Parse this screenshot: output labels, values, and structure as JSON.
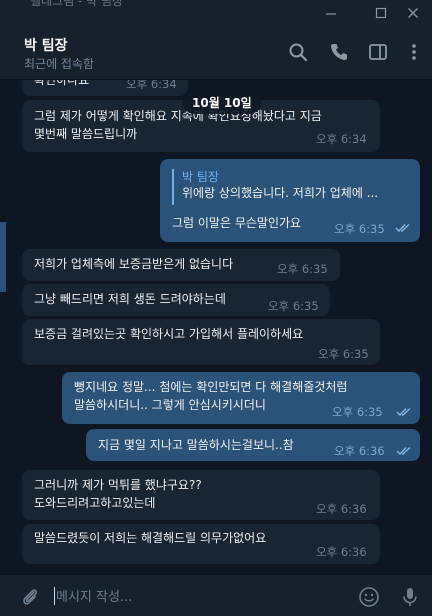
{
  "titlebar": {
    "ghost_text": "텔레그램 - 박 팀장"
  },
  "header": {
    "name": "박 팀장",
    "status": "최근에 접속함"
  },
  "date_separator": "10월 10일",
  "messages": [
    {
      "dir": "in",
      "text": "확인하나요",
      "time": "오후 6:34"
    },
    {
      "dir": "in",
      "lines": [
        "그럼 제가 어떻게 확인해요 지속에 확인요청해놨다고 지금",
        "몇번째 말씀드립니까"
      ],
      "time": "오후 6:34"
    },
    {
      "dir": "out",
      "reply_name": "박 팀장",
      "reply_text": "위에랑 상의했습니다.  저희가 업체에 ...",
      "text": "그럼 이말은 무슨말인가요",
      "time": "오후 6:35",
      "read": true
    },
    {
      "dir": "in",
      "text": "저희가 업체측에 보증금받은게 없습니다",
      "time": "오후 6:35"
    },
    {
      "dir": "in",
      "text": "그냥 빼드리면 저희 생돈 드려야하는데",
      "time": "오후 6:35"
    },
    {
      "dir": "in",
      "text": "보증금 걸려있는곳 확인하시고 가입해서 플레이하세요",
      "time": "오후 6:35"
    },
    {
      "dir": "out",
      "lines": [
        "뻥지네요 정말... 첨에는 확인만되면 다 해결해줄것처럼",
        "말씀하시더니.. 그렇게 안심시키시더니"
      ],
      "time": "오후 6:35",
      "read": true
    },
    {
      "dir": "out",
      "text": "지금 몇일 지나고 말씀하시는걸보니..참",
      "time": "오후 6:36",
      "read": true
    },
    {
      "dir": "in",
      "lines": [
        "그러니까 제가 먹튀를 했냐구요??",
        "도와드리려고하고있는데"
      ],
      "time": "오후 6:36"
    },
    {
      "dir": "in",
      "text": "말씀드렸듯이 저희는 해결해드릴 의무가없어요",
      "time": "오후 6:36"
    }
  ],
  "composer": {
    "placeholder": "메시지 작성..."
  },
  "icons": {
    "minimize": "minimize-icon",
    "maximize": "maximize-icon",
    "close": "close-icon",
    "search": "search-icon",
    "call": "phone-icon",
    "sidebar": "sidebar-icon",
    "menu": "more-vertical-icon",
    "attach": "paperclip-icon",
    "emoji": "emoji-icon",
    "voice": "microphone-icon"
  },
  "colors": {
    "background": "#0e1621",
    "panel": "#17212b",
    "incoming": "#182533",
    "outgoing": "#2b5278",
    "accent": "#6ab3f3"
  }
}
